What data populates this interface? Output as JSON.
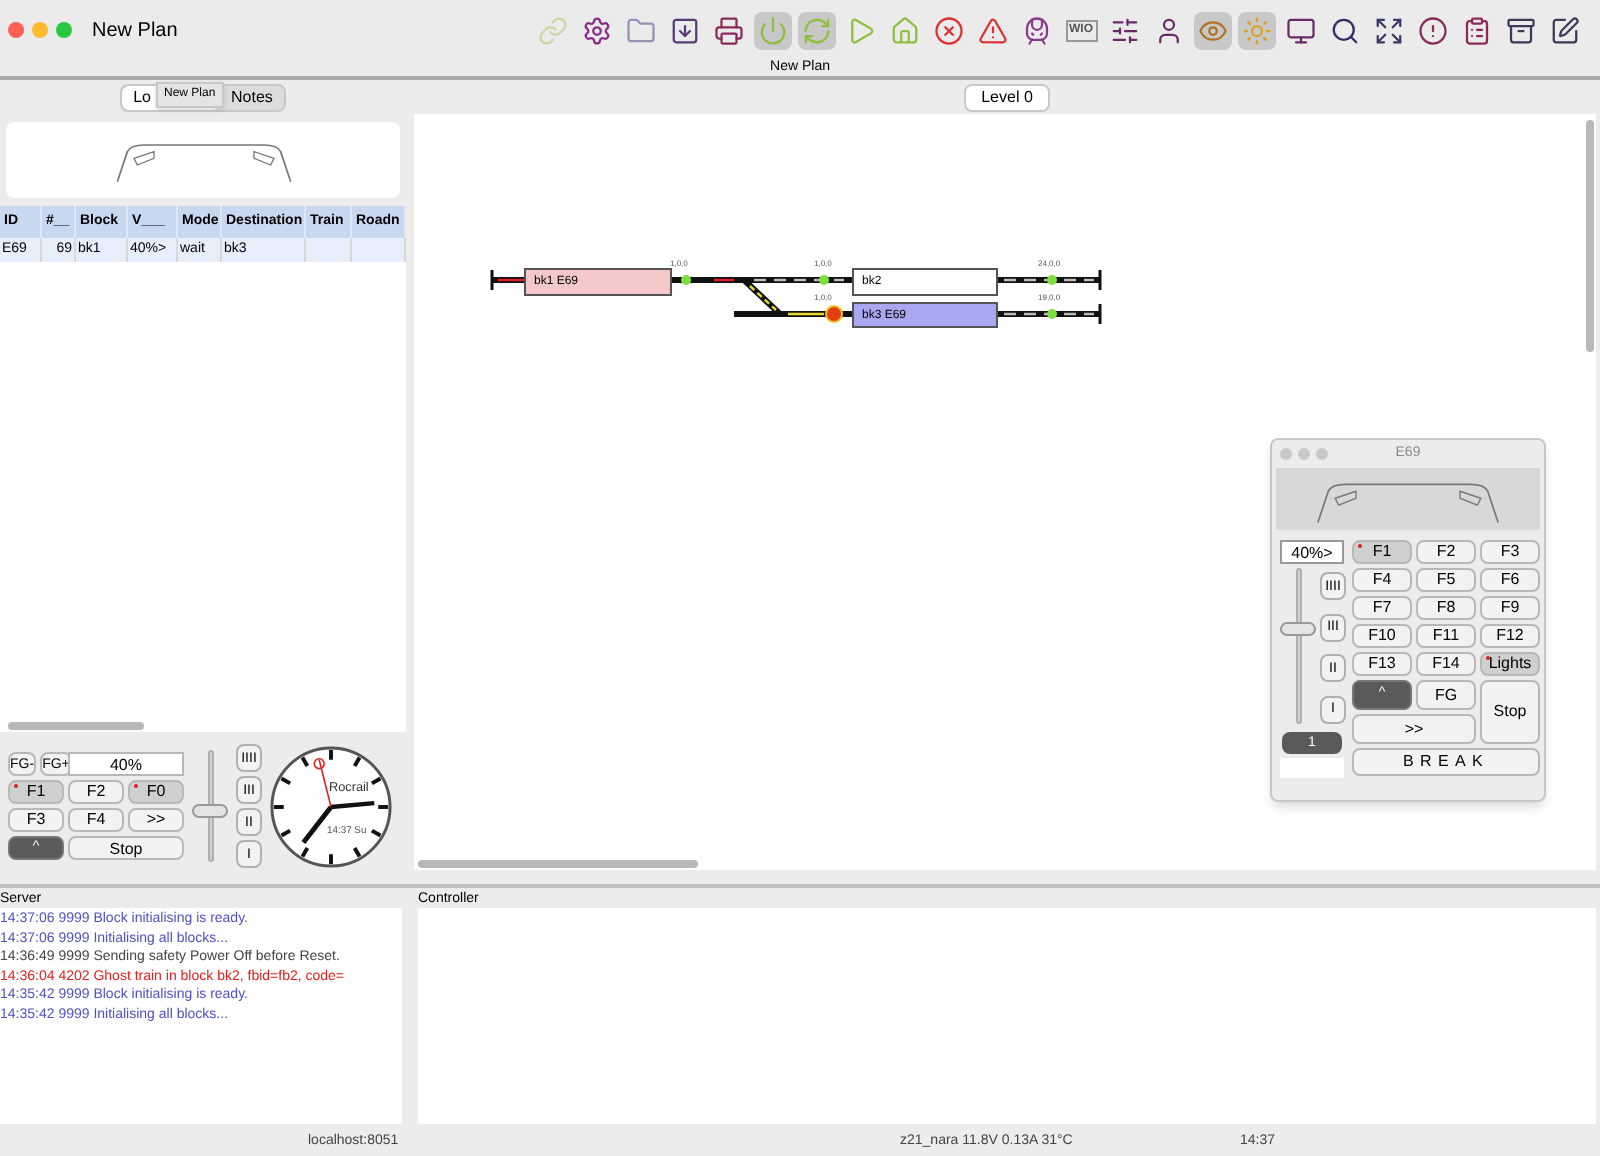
{
  "window": {
    "title": "New Plan",
    "subtitle": "New Plan",
    "tooltip": "New Plan"
  },
  "toolbar": [
    {
      "on": false,
      "color": "#c9d9a3"
    },
    {
      "on": false,
      "color": "#8b2a8b"
    },
    {
      "on": false,
      "color": "#9a8fb8"
    },
    {
      "on": false,
      "color": "#5a3a7a"
    },
    {
      "on": false,
      "color": "#8b2a5a"
    },
    {
      "on": true,
      "color": "#8fbf3f"
    },
    {
      "on": true,
      "color": "#8fbf3f"
    },
    {
      "on": false,
      "color": "#8fbf3f"
    },
    {
      "on": false,
      "color": "#8fbf3f"
    },
    {
      "on": false,
      "color": "#e03030"
    },
    {
      "on": false,
      "color": "#e03030"
    },
    {
      "on": false,
      "color": "#8b3a8b"
    },
    {
      "on": false,
      "color": "#555555",
      "label": "WIO"
    },
    {
      "on": false,
      "color": "#6a2a6a"
    },
    {
      "on": false,
      "color": "#6a2a6a"
    },
    {
      "on": true,
      "color": "#b07020"
    },
    {
      "on": true,
      "color": "#e0a020"
    },
    {
      "on": false,
      "color": "#6a2a6a"
    },
    {
      "on": false,
      "color": "#3a2a6a"
    },
    {
      "on": false,
      "color": "#3a3a6a"
    },
    {
      "on": false,
      "color": "#8b2a5a"
    },
    {
      "on": false,
      "color": "#8b2a5a"
    },
    {
      "on": false,
      "color": "#3a3a5a"
    },
    {
      "on": false,
      "color": "#3a3a5a"
    }
  ],
  "left_panel": {
    "tabs": [
      {
        "label": "Lo",
        "selected": true
      },
      {
        "label": "Notes",
        "selected": false
      }
    ],
    "loco_table": {
      "columns": [
        "ID",
        "#__",
        "Block",
        "V___",
        "Mode",
        "Destination",
        "Train",
        "Roadn"
      ],
      "rows": [
        {
          "cells": [
            "E69",
            "69",
            "bk1",
            "40%>",
            "wait",
            "bk3"
          ],
          "selected": true
        }
      ]
    },
    "throttle": {
      "fg_buttons": [
        "FG-",
        "FG+"
      ],
      "speed": "40%",
      "level": 0.45,
      "functions": [
        {
          "label": "F1",
          "on": true
        },
        {
          "label": "F2",
          "on": false
        },
        {
          "label": "F0",
          "on": true
        },
        {
          "label": "F3",
          "on": false
        },
        {
          "label": "F4",
          "on": false
        },
        {
          "label": ">>",
          "on": false
        }
      ],
      "direction": {
        "label": "^",
        "on": true
      },
      "stop": "Stop",
      "steps": [
        "IIII",
        "III",
        "II",
        "I"
      ]
    },
    "clock": {
      "brand": "Rocrail",
      "time": "14:37 Su"
    }
  },
  "plan": {
    "tabs": [
      {
        "label": "Level 0",
        "selected": true
      }
    ],
    "blocks": [
      {
        "label": "bk1 E69",
        "color": "#f4c8c8"
      },
      {
        "label": "bk2",
        "color": "#ffffff"
      },
      {
        "label": "bk3 E69",
        "color": "#a8a8f0"
      }
    ],
    "sensor_labels": [
      "1,0,0",
      "1,0,0",
      "24,0,0",
      "1,0,0",
      "19,0,0"
    ]
  },
  "loco_window": {
    "title": "E69",
    "speed": "40%>",
    "level": 0.6,
    "steps": [
      "IIII",
      "III",
      "II",
      "I"
    ],
    "address": "1",
    "functions": [
      {
        "label": "F1",
        "on": true
      },
      {
        "label": "F2",
        "on": false
      },
      {
        "label": "F3",
        "on": false
      },
      {
        "label": "F4",
        "on": false
      },
      {
        "label": "F5",
        "on": false
      },
      {
        "label": "F6",
        "on": false
      },
      {
        "label": "F7",
        "on": false
      },
      {
        "label": "F8",
        "on": false
      },
      {
        "label": "F9",
        "on": false
      },
      {
        "label": "F10",
        "on": false
      },
      {
        "label": "F11",
        "on": false
      },
      {
        "label": "F12",
        "on": false
      },
      {
        "label": "F13",
        "on": false
      },
      {
        "label": "F14",
        "on": false
      },
      {
        "label": "Lights",
        "on": true
      }
    ],
    "direction": {
      "label": "^",
      "on": true
    },
    "fg": "FG",
    "forward": ">>",
    "stop": "Stop",
    "brake": "BREAK"
  },
  "server_log": {
    "title": "Server",
    "lines": [
      {
        "text": "14:37:06 9999 Block initialising is ready.",
        "kind": "info"
      },
      {
        "text": "14:37:06 9999 Initialising all blocks...",
        "kind": "info"
      },
      {
        "text": "14:36:49 9999 Sending safety Power Off before Reset.",
        "kind": "plain"
      },
      {
        "text": "14:36:04 4202 Ghost train in block bk2, fbid=fb2, code=",
        "kind": "error"
      },
      {
        "text": "14:35:42 9999 Block initialising is ready.",
        "kind": "info"
      },
      {
        "text": "14:35:42 9999 Initialising all blocks...",
        "kind": "info"
      }
    ]
  },
  "controller": {
    "title": "Controller"
  },
  "status_bar": [
    "localhost:8051",
    "z21_nara 11.8V 0.13A 31°C",
    "14:37"
  ]
}
